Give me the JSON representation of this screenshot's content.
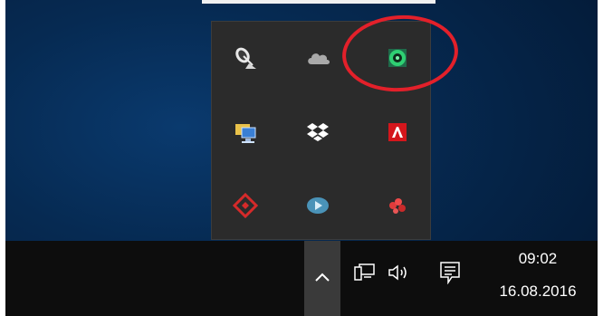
{
  "clock": {
    "time": "09:02",
    "date": "16.08.2016"
  },
  "overflow_icons": [
    [
      "satellite-dish-icon",
      "cloud-icon",
      "green-eye-app-icon"
    ],
    [
      "network-computer-icon",
      "dropbox-icon",
      "adobe-acrobat-icon"
    ],
    [
      "red-diamond-app-icon",
      "video-play-icon",
      "red-dots-app-icon"
    ]
  ],
  "system_tray": [
    "chevron-up-icon",
    "network-icon",
    "volume-icon",
    "action-center-icon"
  ],
  "colors": {
    "highlight": "#e3202a",
    "taskbar": "#0d0d0d",
    "panel": "#2b2b2b",
    "accent_green": "#2fd073"
  }
}
